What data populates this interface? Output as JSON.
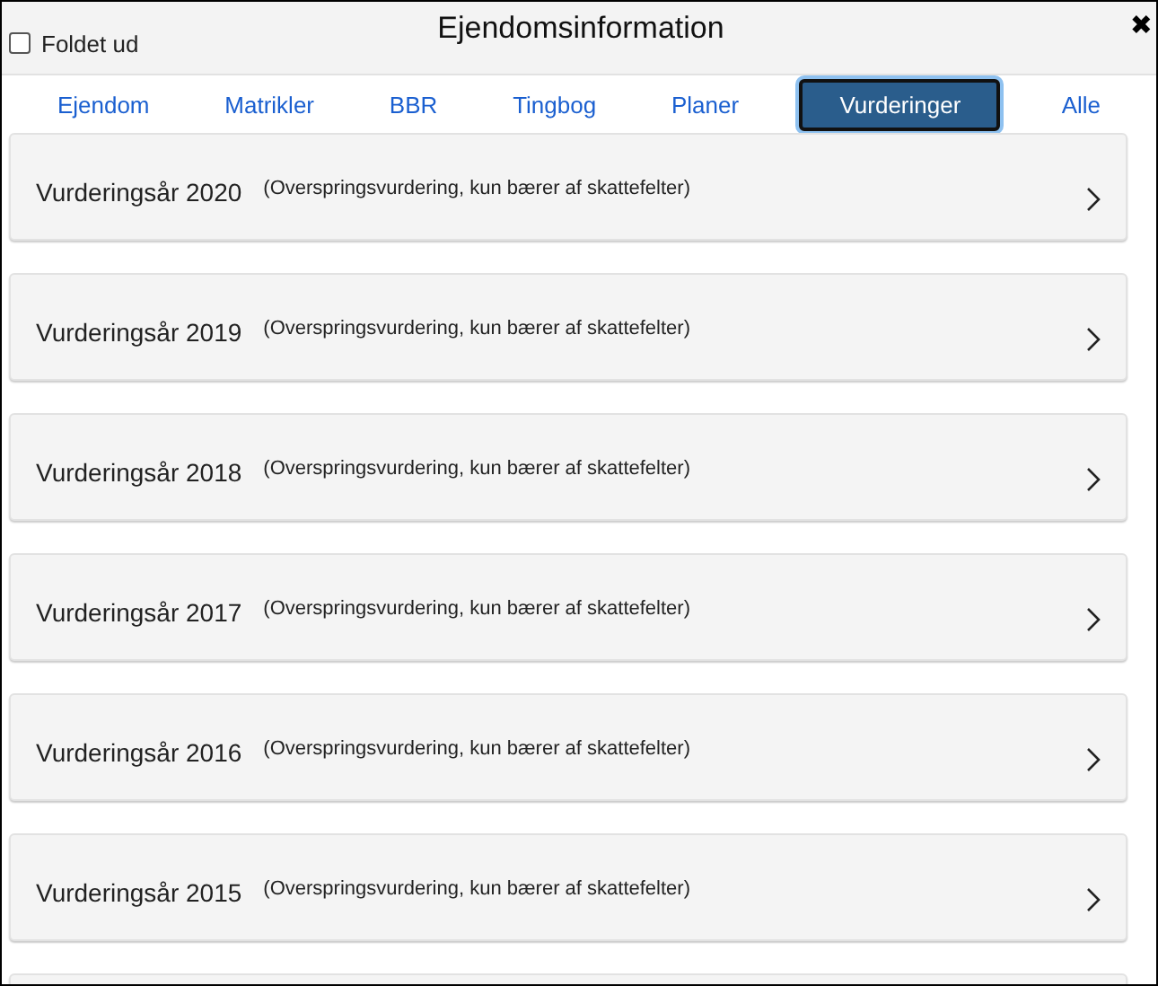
{
  "header": {
    "checkbox": {
      "label": "Foldet ud",
      "checked": false
    },
    "title": "Ejendomsinformation",
    "close": "✖"
  },
  "tabs": [
    {
      "label": "Ejendom",
      "selected": false
    },
    {
      "label": "Matrikler",
      "selected": false
    },
    {
      "label": "BBR",
      "selected": false
    },
    {
      "label": "Tingbog",
      "selected": false
    },
    {
      "label": "Planer",
      "selected": false
    },
    {
      "label": "Vurderinger",
      "selected": true
    },
    {
      "label": "Alle",
      "selected": false
    }
  ],
  "valuations": [
    {
      "title": "Vurderingsår 2020",
      "note": "(Overspringsvurdering, kun bærer af skattefelter)"
    },
    {
      "title": "Vurderingsår 2019",
      "note": "(Overspringsvurdering, kun bærer af skattefelter)"
    },
    {
      "title": "Vurderingsår 2018",
      "note": "(Overspringsvurdering, kun bærer af skattefelter)"
    },
    {
      "title": "Vurderingsår 2017",
      "note": "(Overspringsvurdering, kun bærer af skattefelter)"
    },
    {
      "title": "Vurderingsår 2016",
      "note": "(Overspringsvurdering, kun bærer af skattefelter)"
    },
    {
      "title": "Vurderingsår 2015",
      "note": "(Overspringsvurdering, kun bærer af skattefelter)"
    }
  ]
}
